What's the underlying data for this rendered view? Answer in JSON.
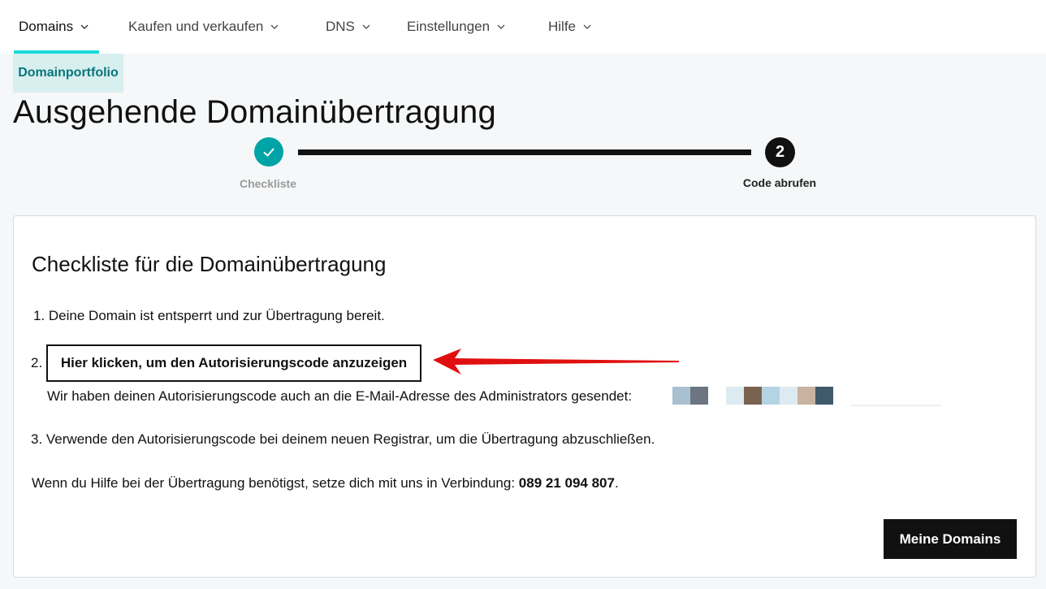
{
  "nav": {
    "items": [
      {
        "label": "Domains"
      },
      {
        "label": "Kaufen und verkaufen"
      },
      {
        "label": "DNS"
      },
      {
        "label": "Einstellungen"
      },
      {
        "label": "Hilfe"
      }
    ],
    "active_index": 0
  },
  "breadcrumb": "Domainportfolio",
  "page_title": "Ausgehende Domainübertragung",
  "stepper": {
    "steps": [
      {
        "number": "1",
        "label": "Checkliste",
        "status": "completed",
        "icon": "check-icon"
      },
      {
        "number": "2",
        "label": "Code abrufen",
        "status": "current"
      }
    ]
  },
  "card": {
    "title": "Checkliste für die Domainübertragung",
    "item1": "1. Deine Domain ist entsperrt und zur Übertragung bereit.",
    "item2_number": "2.",
    "item2_button": "Hier klicken, um den Autorisierungscode anzuzeigen",
    "item2_note": "Wir haben deinen Autorisierungscode auch an die E-Mail-Adresse des Administrators gesendet:",
    "item3": "3. Verwende den Autorisierungscode bei deinem neuen Registrar, um die Übertragung abzuschließen.",
    "help_text": "Wenn du Hilfe bei der Übertragung benötigst, setze dich mit uns in Verbindung:",
    "help_phone": "089 21 094 807",
    "help_period": ".",
    "primary_button": "Meine Domains"
  },
  "colors": {
    "accent_teal": "#00a4a6",
    "nav_underline": "#1bdbdb",
    "breadcrumb_bg": "#d8efef",
    "breadcrumb_text": "#09757a",
    "annotation_arrow": "#e01010"
  }
}
